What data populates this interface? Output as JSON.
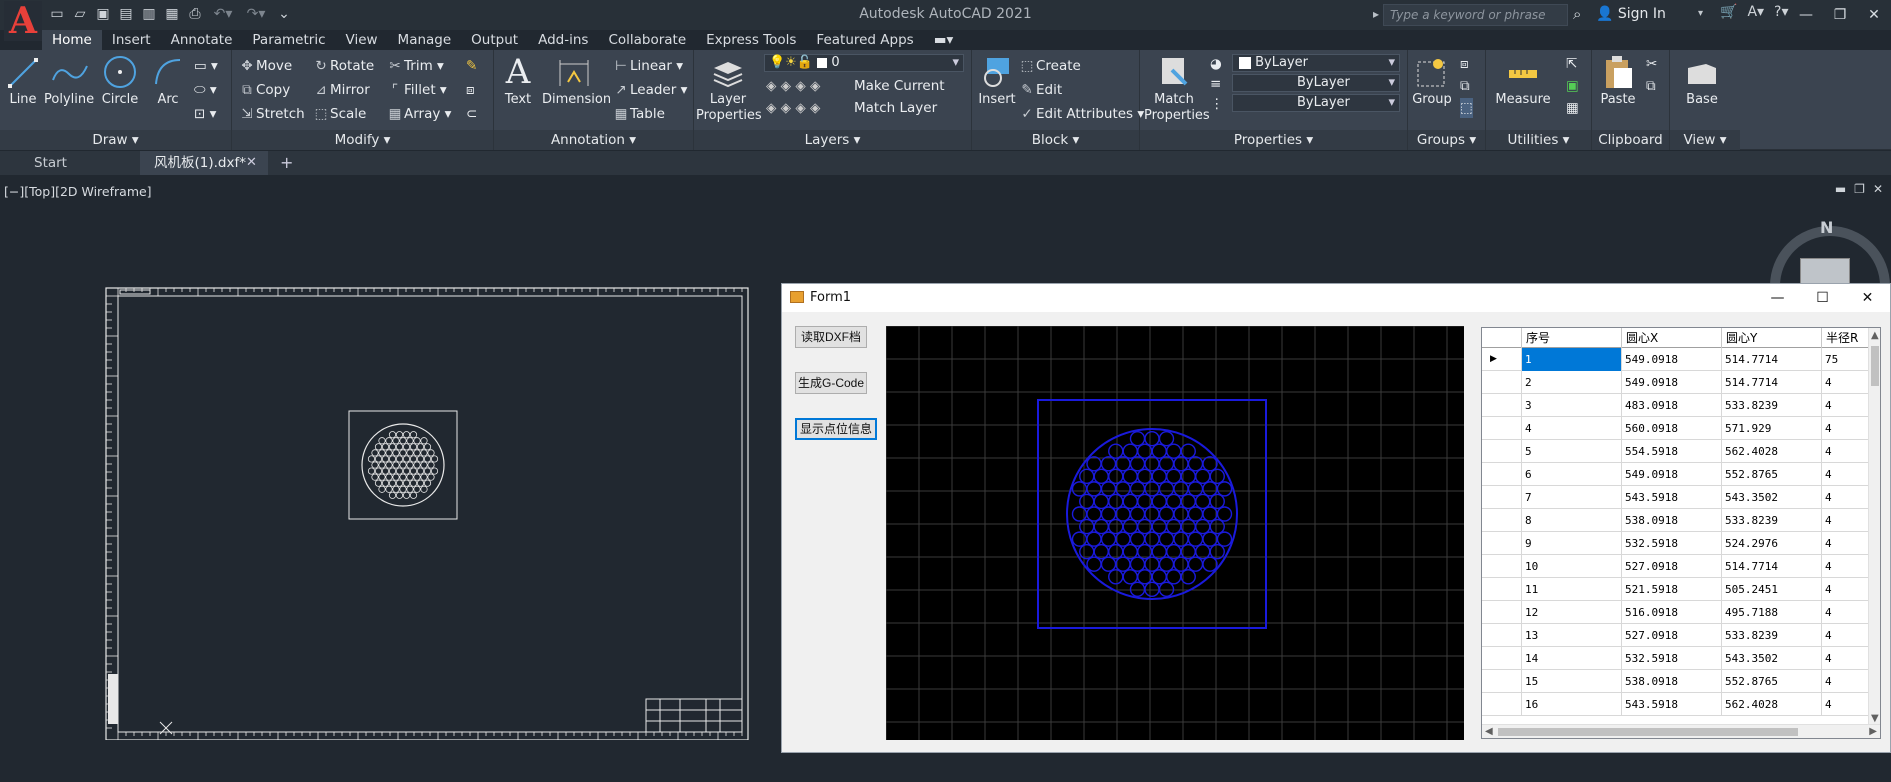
{
  "app": {
    "title": "Autodesk AutoCAD 2021",
    "logo": "A"
  },
  "search": {
    "placeholder": "Type a keyword or phrase"
  },
  "account": {
    "signin_label": "Sign In"
  },
  "menu_tabs": [
    "Home",
    "Insert",
    "Annotate",
    "Parametric",
    "View",
    "Manage",
    "Output",
    "Add-ins",
    "Collaborate",
    "Express Tools",
    "Featured Apps"
  ],
  "ribbon": {
    "draw": {
      "title": "Draw ▾",
      "line": "Line",
      "polyline": "Polyline",
      "circle": "Circle",
      "arc": "Arc"
    },
    "modify": {
      "title": "Modify ▾",
      "move": "Move",
      "rotate": "Rotate",
      "trim": "Trim",
      "copy": "Copy",
      "mirror": "Mirror",
      "fillet": "Fillet",
      "stretch": "Stretch",
      "scale": "Scale",
      "array": "Array"
    },
    "annotation": {
      "title": "Annotation ▾",
      "text": "Text",
      "dimension": "Dimension",
      "linear": "Linear",
      "leader": "Leader",
      "table": "Table"
    },
    "layers": {
      "title": "Layers ▾",
      "layer_properties_1": "Layer",
      "layer_properties_2": "Properties",
      "current_layer": "0",
      "make_current": "Make Current",
      "match_layer": "Match Layer"
    },
    "block": {
      "title": "Block ▾",
      "insert": "Insert",
      "create": "Create",
      "edit": "Edit",
      "edit_attributes": "Edit Attributes"
    },
    "properties": {
      "title": "Properties ▾",
      "match_1": "Match",
      "match_2": "Properties",
      "color": "ByLayer",
      "linetype": "ByLayer",
      "lineweight": "ByLayer"
    },
    "groups": {
      "title": "Groups ▾",
      "group": "Group"
    },
    "utilities": {
      "title": "Utilities ▾",
      "measure": "Measure"
    },
    "clipboard": {
      "title": "Clipboard",
      "paste": "Paste"
    },
    "view": {
      "title": "View ▾",
      "base": "Base"
    }
  },
  "file_tabs": {
    "start": "Start",
    "active": "风机板(1).dxf*"
  },
  "viewport": {
    "label": "[−][Top][2D Wireframe]",
    "compass_n": "N"
  },
  "form1": {
    "title": "Form1",
    "btn_read": "读取DXF档",
    "btn_gcode": "生成G-Code",
    "btn_show": "显示点位信息",
    "columns": [
      "序号",
      "圆心X",
      "圆心Y",
      "半径R"
    ],
    "rows": [
      [
        "1",
        "549.0918",
        "514.7714",
        "75"
      ],
      [
        "2",
        "549.0918",
        "514.7714",
        "4"
      ],
      [
        "3",
        "483.0918",
        "533.8239",
        "4"
      ],
      [
        "4",
        "560.0918",
        "571.929",
        "4"
      ],
      [
        "5",
        "554.5918",
        "562.4028",
        "4"
      ],
      [
        "6",
        "549.0918",
        "552.8765",
        "4"
      ],
      [
        "7",
        "543.5918",
        "543.3502",
        "4"
      ],
      [
        "8",
        "538.0918",
        "533.8239",
        "4"
      ],
      [
        "9",
        "532.5918",
        "524.2976",
        "4"
      ],
      [
        "10",
        "527.0918",
        "514.7714",
        "4"
      ],
      [
        "11",
        "521.5918",
        "505.2451",
        "4"
      ],
      [
        "12",
        "516.0918",
        "495.7188",
        "4"
      ],
      [
        "13",
        "527.0918",
        "533.8239",
        "4"
      ],
      [
        "14",
        "532.5918",
        "543.3502",
        "4"
      ],
      [
        "15",
        "538.0918",
        "552.8765",
        "4"
      ],
      [
        "16",
        "543.5918",
        "562.4028",
        "4"
      ]
    ]
  }
}
